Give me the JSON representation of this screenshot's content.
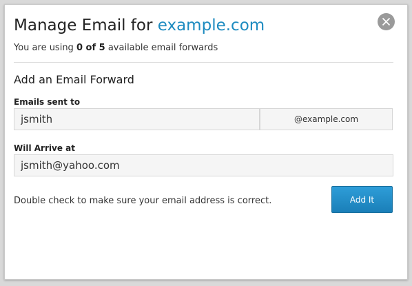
{
  "header": {
    "title_prefix": "Manage Email for",
    "title_domain": "example.com",
    "usage_prefix": "You are using",
    "usage_count": "0 of 5",
    "usage_suffix": "available email forwards",
    "close_icon": "close-icon"
  },
  "form": {
    "section_title": "Add an Email Forward",
    "sent_to_label": "Emails sent to",
    "sent_to_value": "jsmith",
    "domain_suffix": "@example.com",
    "arrive_label": "Will Arrive at",
    "arrive_value": "jsmith@yahoo.com",
    "hint": "Double check to make sure your email address is correct.",
    "submit_label": "Add It"
  },
  "colors": {
    "accent": "#1d8bc0",
    "button": "#1a86c2",
    "close_bg": "#9a9a9a"
  }
}
